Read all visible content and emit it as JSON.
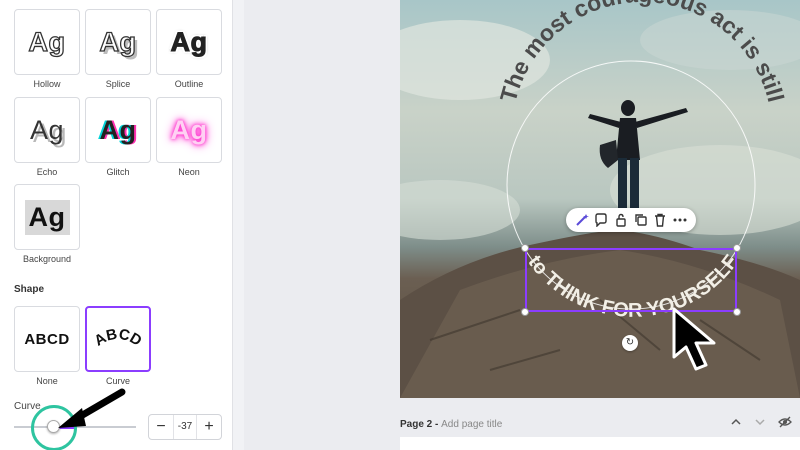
{
  "effects": [
    {
      "label": "Hollow",
      "sample": "Ag",
      "style": "hollow"
    },
    {
      "label": "Splice",
      "sample": "Ag",
      "style": "splice"
    },
    {
      "label": "Outline",
      "sample": "Ag",
      "style": "outline"
    },
    {
      "label": "Echo",
      "sample": "Ag",
      "style": "echo"
    },
    {
      "label": "Glitch",
      "sample": "Ag",
      "style": "glitch"
    },
    {
      "label": "Neon",
      "sample": "Ag",
      "style": "neon"
    },
    {
      "label": "Background",
      "sample": "Ag",
      "style": "background"
    }
  ],
  "shape": {
    "title": "Shape",
    "options": [
      {
        "label": "None",
        "sample": "ABCD",
        "selected": false
      },
      {
        "label": "Curve",
        "sample": "ABCD",
        "selected": true
      }
    ]
  },
  "curve": {
    "label": "Curve",
    "value": "-37",
    "minus": "−",
    "plus": "+",
    "slider_fraction": 0.33
  },
  "canvas": {
    "top_text": "The most courageous act is still",
    "bottom_text": "to THINK FOR YOURSELF",
    "toolbar_icons": [
      "magic-edit-icon",
      "comment-icon",
      "lock-icon",
      "duplicate-icon",
      "delete-icon",
      "more-icon"
    ]
  },
  "page2": {
    "prefix": "Page 2 - ",
    "placeholder": "Add page title"
  },
  "colors": {
    "accent": "#8b3dff",
    "highlight_ring": "#2ec4a0"
  }
}
